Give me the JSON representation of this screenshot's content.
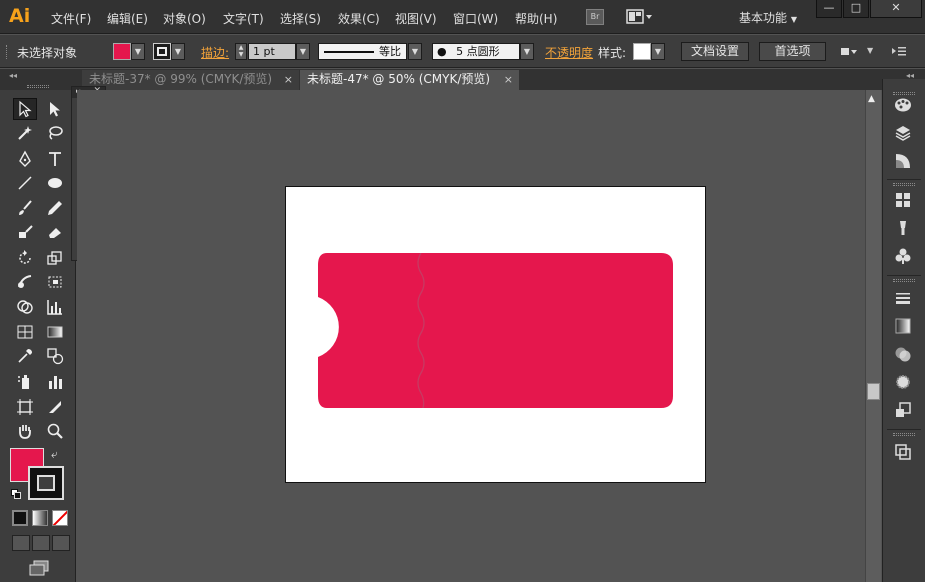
{
  "app": {
    "logo": "Ai",
    "workspace": "基本功能"
  },
  "menu": [
    {
      "label": "文件(F)",
      "name": "menu-file"
    },
    {
      "label": "编辑(E)",
      "name": "menu-edit"
    },
    {
      "label": "对象(O)",
      "name": "menu-object"
    },
    {
      "label": "文字(T)",
      "name": "menu-type"
    },
    {
      "label": "选择(S)",
      "name": "menu-select"
    },
    {
      "label": "效果(C)",
      "name": "menu-effect"
    },
    {
      "label": "视图(V)",
      "name": "menu-view"
    },
    {
      "label": "窗口(W)",
      "name": "menu-window"
    },
    {
      "label": "帮助(H)",
      "name": "menu-help"
    }
  ],
  "bridge_label": "Br",
  "window_controls": {
    "minimize": "—",
    "maximize": "□",
    "close": "✕"
  },
  "control": {
    "selection": "未选择对象",
    "stroke_label": "描边:",
    "stroke_weight": "1 pt",
    "stroke_profile": "等比",
    "brush": "5 点圆形",
    "opacity_label": "不透明度",
    "style_label": "样式:",
    "doc_setup": "文档设置",
    "preferences": "首选项"
  },
  "tabs": [
    {
      "label": "未标题-37* @ 99% (CMYK/预览)",
      "active": false
    },
    {
      "label": "未标题-47* @ 50% (CMYK/预览)",
      "active": true
    }
  ],
  "tab_close": "×",
  "colors": {
    "fill": "#e5174d",
    "ticket": "#e5174d",
    "perforation": "#c73a62",
    "accent": "#f7a21b"
  },
  "tools": [
    "selection-tool-icon",
    "direct-selection-tool-icon",
    "magic-wand-tool-icon",
    "lasso-tool-icon",
    "pen-tool-icon",
    "type-tool-icon",
    "line-tool-icon",
    "ellipse-tool-icon",
    "paintbrush-tool-icon",
    "pencil-tool-icon",
    "blob-brush-tool-icon",
    "eraser-tool-icon",
    "rotate-tool-icon",
    "scale-tool-icon",
    "warp-tool-icon",
    "free-transform-tool-icon",
    "shape-builder-tool-icon",
    "graph-tool-icon",
    "mesh-tool-icon",
    "gradient-tool-icon",
    "eyedropper-tool-icon",
    "blend-tool-icon",
    "symbol-sprayer-tool-icon",
    "column-graph-tool-icon",
    "artboard-tool-icon",
    "slice-tool-icon",
    "hand-tool-icon",
    "zoom-tool-icon"
  ],
  "flyout_tools": [
    "rectangle-tool-icon",
    "rounded-rectangle-tool-icon",
    "ellipse-tool-icon",
    "polygon-tool-icon",
    "star-tool-icon",
    "flare-tool-icon"
  ],
  "dock": [
    "color-panel-icon",
    "layers-panel-icon",
    "color-guide-panel-icon",
    "swatches-panel-icon",
    "brushes-panel-icon",
    "symbols-panel-icon",
    "stroke-panel-icon",
    "gradient-panel-icon",
    "transparency-panel-icon",
    "appearance-panel-icon",
    "graphic-styles-panel-icon",
    "pathfinder-panel-icon"
  ]
}
